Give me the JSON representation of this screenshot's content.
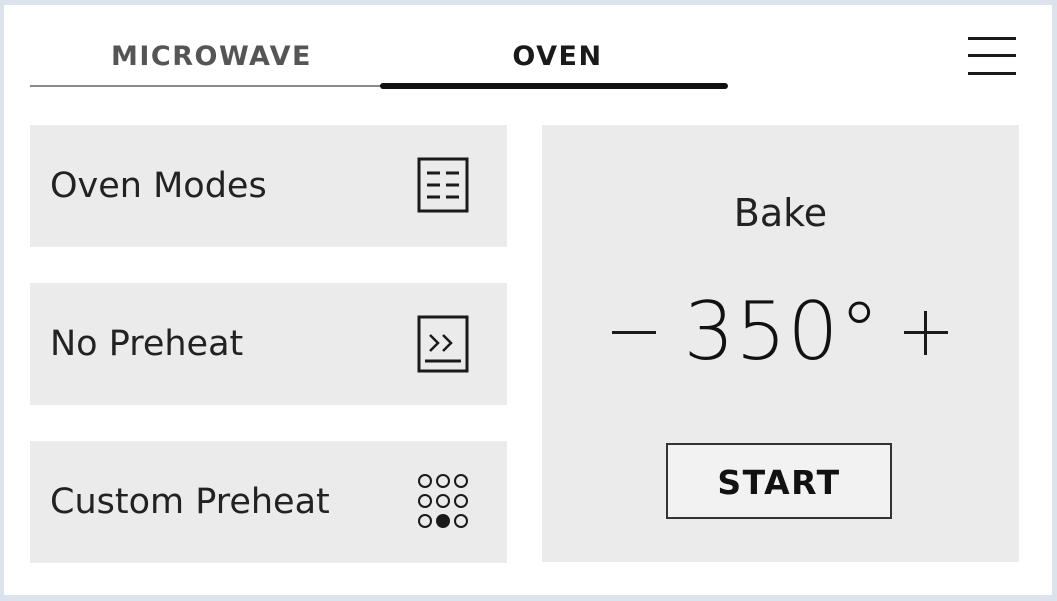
{
  "tabs": [
    {
      "label": "MICROWAVE",
      "active": false
    },
    {
      "label": "OVEN",
      "active": true
    }
  ],
  "menu": {
    "icon": "hamburger-menu-icon"
  },
  "options": [
    {
      "label": "Oven Modes",
      "icon": "list-grid-icon"
    },
    {
      "label": "No Preheat",
      "icon": "skip-forward-icon"
    },
    {
      "label": "Custom Preheat",
      "icon": "keypad-dots-icon"
    }
  ],
  "bake": {
    "mode": "Bake",
    "temperature": "350°",
    "decrease_icon": "minus-icon",
    "increase_icon": "plus-icon",
    "start_label": "START"
  },
  "colors": {
    "panel": "#ebebeb",
    "accent": "#111111",
    "background": "#ffffff",
    "outer": "#dbe4ec"
  }
}
